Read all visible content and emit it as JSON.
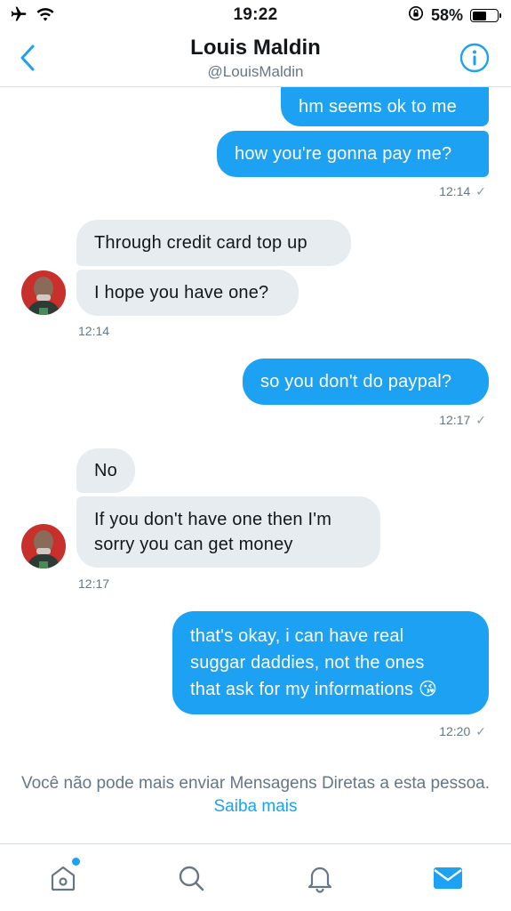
{
  "status": {
    "time": "19:22",
    "battery_percent_label": "58%",
    "battery_level": 0.58,
    "icons": [
      "airplane-icon",
      "wifi-icon",
      "orientation-lock-icon",
      "battery-icon"
    ]
  },
  "header": {
    "name": "Louis Maldin",
    "handle": "@LouisMaldin",
    "back_icon": "chevron-left-icon",
    "info_icon": "info-icon"
  },
  "messages": {
    "m1": "hm seems ok to me",
    "m2": "how you're gonna pay me?",
    "t1": "12:14",
    "m3": "Through credit card top up",
    "m4": "I hope you have one?",
    "t2": "12:14",
    "m5": "so you don't do paypal?",
    "t3": "12:17",
    "m6": "No",
    "m7a": "If you don't have one then I'm",
    "m7b": "sorry you can get money",
    "t4": "12:17",
    "m8a": "that's okay, i can have real",
    "m8b": "suggar daddies, not the ones",
    "m8c": "that ask for my informations",
    "m8_emoji": "😘",
    "t5": "12:20",
    "check": "✓"
  },
  "notice": {
    "text": "Você não pode mais enviar Mensagens Diretas a esta pessoa.",
    "link": "Saiba mais"
  },
  "tabbar": {
    "items": [
      "home-icon",
      "search-icon",
      "notifications-icon",
      "messages-icon"
    ],
    "active": "messages-icon",
    "accent": "#1da1f2"
  },
  "colors": {
    "outgoing_bubble": "#1da1f2",
    "incoming_bubble": "#e6ecf0",
    "secondary_text": "#657786"
  }
}
